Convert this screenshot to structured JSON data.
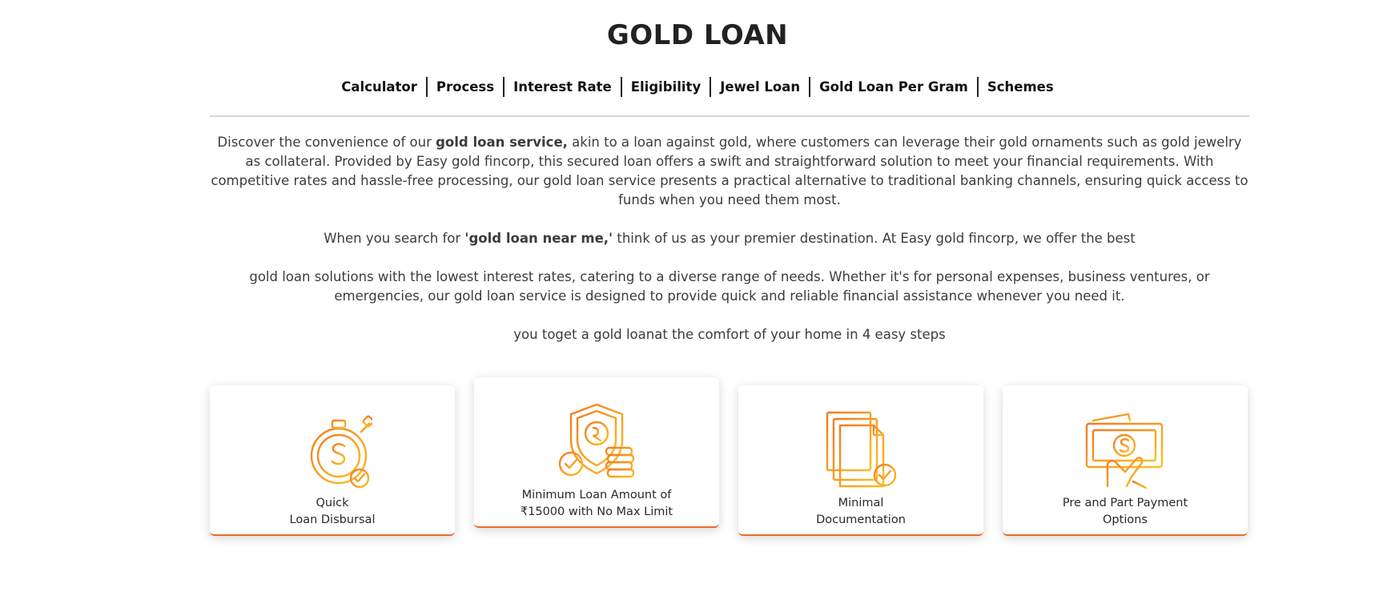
{
  "page": {
    "title": "GOLD LOAN"
  },
  "nav": {
    "items": [
      "Calculator",
      "Process",
      "Interest Rate",
      "Eligibility",
      "Jewel Loan",
      "Gold Loan Per Gram",
      "Schemes"
    ]
  },
  "intro": {
    "p1_before": "Discover the convenience of our ",
    "p1_bold": "gold loan service,",
    "p1_after": " akin to a loan against gold, where customers can leverage their gold ornaments such as gold jewelry as collateral. Provided by Easy gold fincorp, this secured loan offers a swift and straightforward solution to meet your financial requirements. With competitive rates and hassle-free processing, our gold loan service presents a practical alternative to traditional banking channels, ensuring quick access to funds when you need them most.",
    "p2_before": "When you search for ",
    "p2_bold": "'gold loan near me,'",
    "p2_after": " think of us as your premier destination. At Easy gold fincorp, we offer the best",
    "p3": "gold loan solutions with the lowest interest rates, catering to a diverse range of needs. Whether it's for personal expenses, business ventures, or emergencies, our gold loan service is designed to provide quick and reliable financial assistance whenever you need it.",
    "p4": "you toget a gold loanat the comfort of your home in 4 easy steps"
  },
  "features": [
    {
      "icon": "stopwatch-dollar-icon",
      "line1": "Quick",
      "line2": "Loan Disbursal"
    },
    {
      "icon": "shield-rupee-coins-icon",
      "line1": "Minimum Loan Amount of",
      "line2": "₹15000 with No Max Limit"
    },
    {
      "icon": "documents-check-icon",
      "line1": "Minimal",
      "line2": "Documentation"
    },
    {
      "icon": "hand-money-icon",
      "line1": "Pre and Part Payment",
      "line2": "Options"
    }
  ],
  "colors": {
    "accent": "#ef6a2a",
    "icon_orange": "#f47b20",
    "icon_yellow": "#fbbf24"
  }
}
